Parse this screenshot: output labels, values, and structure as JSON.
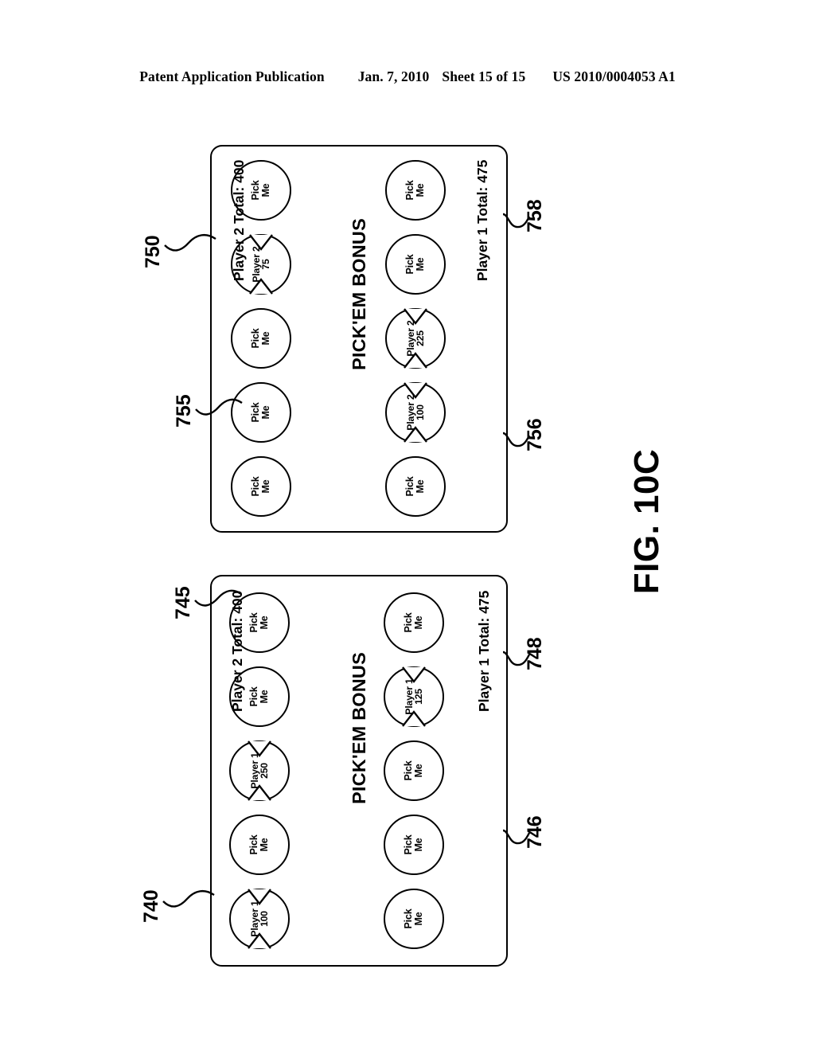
{
  "header": {
    "publication": "Patent Application Publication",
    "date": "Jan. 7, 2010",
    "sheet": "Sheet 15 of 15",
    "docnum": "US 2010/0004053 A1"
  },
  "figure": {
    "caption": "FIG. 10C",
    "ink_color": "#000000",
    "background_color": "#ffffff"
  },
  "panels": [
    {
      "id": "panel-top",
      "ref_frame": "750",
      "ref_disc": "755",
      "ref_total_p1": "756",
      "ref_total_p2": "758",
      "title": "PICK'EM BONUS",
      "total_player1": "Player 1 Total: 475",
      "total_player2": "Player 2 Total: 400",
      "rows": [
        {
          "name": "top-row",
          "discs": [
            {
              "state": "unpicked",
              "line1": "Pick",
              "line2": "Me"
            },
            {
              "state": "unpicked",
              "line1": "Pick",
              "line2": "Me"
            },
            {
              "state": "unpicked",
              "line1": "Pick",
              "line2": "Me"
            },
            {
              "state": "revealed",
              "line1": "Player 2",
              "line2": "75"
            },
            {
              "state": "unpicked",
              "line1": "Pick",
              "line2": "Me"
            }
          ]
        },
        {
          "name": "bottom-row",
          "discs": [
            {
              "state": "unpicked",
              "line1": "Pick",
              "line2": "Me"
            },
            {
              "state": "revealed",
              "line1": "Player 2",
              "line2": "100"
            },
            {
              "state": "revealed",
              "line1": "Player 2",
              "line2": "225"
            },
            {
              "state": "unpicked",
              "line1": "Pick",
              "line2": "Me"
            },
            {
              "state": "unpicked",
              "line1": "Pick",
              "line2": "Me"
            }
          ]
        }
      ]
    },
    {
      "id": "panel-bottom",
      "ref_frame": "740",
      "ref_disc": "745",
      "ref_total_p1": "746",
      "ref_total_p2": "748",
      "title": "PICK'EM BONUS",
      "total_player1": "Player 1 Total: 475",
      "total_player2": "Player 2 Total: 400",
      "rows": [
        {
          "name": "top-row",
          "discs": [
            {
              "state": "revealed",
              "line1": "Player 1",
              "line2": "100"
            },
            {
              "state": "unpicked",
              "line1": "Pick",
              "line2": "Me"
            },
            {
              "state": "revealed",
              "line1": "Player 1",
              "line2": "250"
            },
            {
              "state": "unpicked",
              "line1": "Pick",
              "line2": "Me"
            },
            {
              "state": "unpicked",
              "line1": "Pick",
              "line2": "Me"
            }
          ]
        },
        {
          "name": "bottom-row",
          "discs": [
            {
              "state": "unpicked",
              "line1": "Pick",
              "line2": "Me"
            },
            {
              "state": "unpicked",
              "line1": "Pick",
              "line2": "Me"
            },
            {
              "state": "unpicked",
              "line1": "Pick",
              "line2": "Me"
            },
            {
              "state": "revealed",
              "line1": "Player 1",
              "line2": "125"
            },
            {
              "state": "unpicked",
              "line1": "Pick",
              "line2": "Me"
            }
          ]
        }
      ]
    }
  ]
}
